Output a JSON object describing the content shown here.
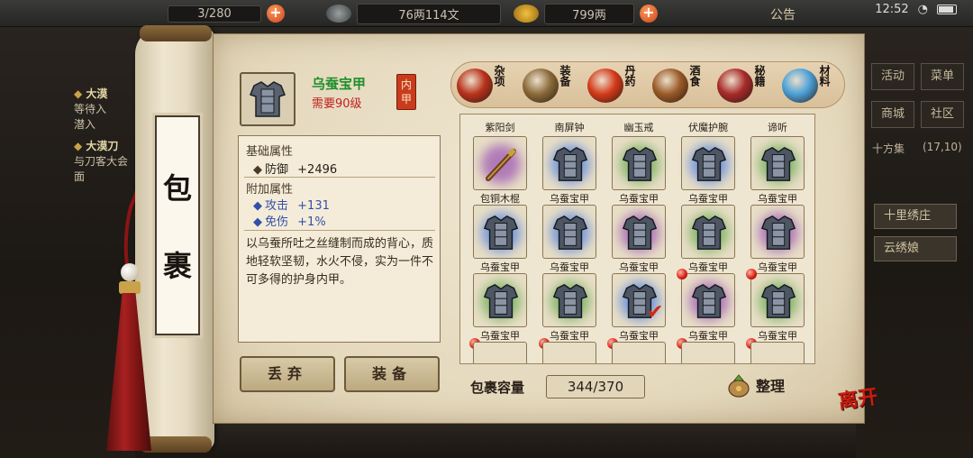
{
  "topbar": {
    "resource1": "3/280",
    "resource2": "76两114文",
    "resource3": "799两",
    "notice": "公告",
    "time": "12:52"
  },
  "quests": [
    {
      "title": "大漠",
      "lines": [
        "等待入",
        "潜入"
      ]
    },
    {
      "title": "大漠刀",
      "lines": [
        "与刀客大会",
        "面"
      ]
    }
  ],
  "right_panel": {
    "buttons": [
      "活动",
      "菜单",
      "商城",
      "社区"
    ],
    "location": "十方集",
    "coords": "(17,10)",
    "slot1": "十里绣庄",
    "slot2": "云绣娘"
  },
  "scroll": {
    "title_char1": "包",
    "title_char2": "裹"
  },
  "item": {
    "name": "乌蚕宝甲",
    "requirement": "需要90级",
    "slot_tag": "内甲",
    "base_header": "基础属性",
    "base_attrs": [
      {
        "name": "防御",
        "value": "+2496"
      }
    ],
    "extra_header": "附加属性",
    "extra_attrs": [
      {
        "name": "攻击",
        "value": "+131"
      },
      {
        "name": "免伤",
        "value": "+1%"
      }
    ],
    "description": "以乌蚕所吐之丝缝制而成的背心，质地轻软坚韧，水火不侵，实为一件不可多得的护身内甲。"
  },
  "actions": {
    "discard": "丢弃",
    "equip": "装备"
  },
  "tabs": [
    {
      "label": "杂项",
      "icon": "jar-icon",
      "color": "#b8321c"
    },
    {
      "label": "装备",
      "icon": "weapon-icon",
      "color": "#8a6a3a"
    },
    {
      "label": "丹药",
      "icon": "pill-icon",
      "color": "#d43a1a"
    },
    {
      "label": "酒食",
      "icon": "food-icon",
      "color": "#9a5a28"
    },
    {
      "label": "秘籍",
      "icon": "book-icon",
      "color": "#a82a2a"
    },
    {
      "label": "材料",
      "icon": "crystal-icon",
      "color": "#4aa0d8"
    }
  ],
  "grid": {
    "top_labels": [
      "紫阳剑",
      "南屏钟",
      "幽玉戒",
      "伏魔护腕",
      "谛听"
    ],
    "rows": [
      [
        {
          "label": "包铜木棍",
          "icon": "staff-icon",
          "glow": "#b07ab8"
        },
        {
          "label": "乌蚕宝甲",
          "icon": "armor-icon",
          "glow": "#7a9ad8"
        },
        {
          "label": "乌蚕宝甲",
          "icon": "armor-icon",
          "glow": "#8ab870"
        },
        {
          "label": "乌蚕宝甲",
          "icon": "armor-icon",
          "glow": "#7a9ad8"
        },
        {
          "label": "乌蚕宝甲",
          "icon": "armor-icon",
          "glow": "#8ab870"
        }
      ],
      [
        {
          "label": "乌蚕宝甲",
          "icon": "armor-icon",
          "glow": "#7a9ad8"
        },
        {
          "label": "乌蚕宝甲",
          "icon": "armor-icon",
          "glow": "#7a9ad8"
        },
        {
          "label": "乌蚕宝甲",
          "icon": "armor-icon",
          "glow": "#b07ab8"
        },
        {
          "label": "乌蚕宝甲",
          "icon": "armor-icon",
          "glow": "#8ab870"
        },
        {
          "label": "乌蚕宝甲",
          "icon": "armor-icon",
          "glow": "#b07ab8"
        }
      ],
      [
        {
          "label": "乌蚕宝甲",
          "icon": "armor-icon",
          "glow": "#8ab870"
        },
        {
          "label": "乌蚕宝甲",
          "icon": "armor-icon",
          "glow": "#8ab870"
        },
        {
          "label": "乌蚕宝甲",
          "icon": "armor-icon",
          "glow": "#7a9ad8",
          "selected": true
        },
        {
          "label": "乌蚕宝甲",
          "icon": "armor-icon",
          "glow": "#b07ab8"
        },
        {
          "label": "乌蚕宝甲",
          "icon": "armor-icon",
          "glow": "#8ab870"
        }
      ]
    ]
  },
  "capacity": {
    "label": "包裹容量",
    "value": "344/370"
  },
  "sort": {
    "label": "整理"
  },
  "close": {
    "label": "离开"
  }
}
